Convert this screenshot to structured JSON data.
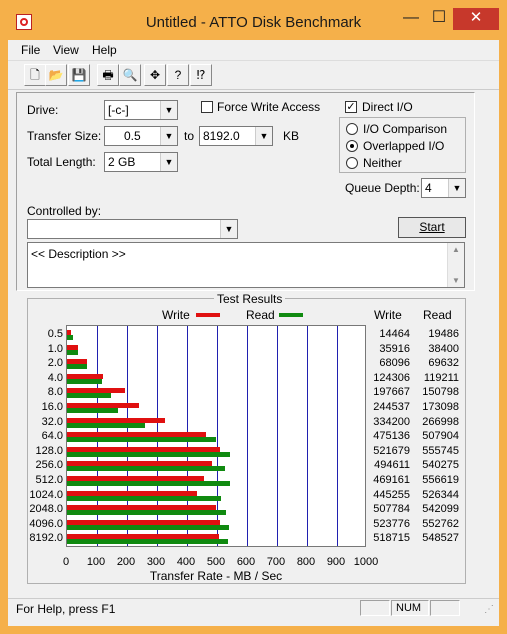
{
  "window": {
    "title": "Untitled - ATTO Disk Benchmark",
    "minimize": "—",
    "maximize": "☐",
    "close": "✕"
  },
  "menu": [
    "File",
    "View",
    "Help"
  ],
  "toolbar": [
    {
      "icon": "new-file-icon",
      "glyph": "🗋"
    },
    {
      "icon": "open-folder-icon",
      "glyph": "📂"
    },
    {
      "icon": "save-disk-icon",
      "glyph": "💾"
    },
    {
      "icon": "print-icon",
      "glyph": "🖶"
    },
    {
      "icon": "print-preview-icon",
      "glyph": "🔍"
    },
    {
      "icon": "move-icon",
      "glyph": "✥"
    },
    {
      "icon": "help-icon",
      "glyph": "?"
    },
    {
      "icon": "context-help-icon",
      "glyph": "⁉"
    }
  ],
  "settings": {
    "drive_label": "Drive:",
    "drive_value": "[-c-]",
    "force_write_label": "Force Write Access",
    "force_write_checked": false,
    "direct_io_label": "Direct I/O",
    "direct_io_checked": true,
    "transfer_size_label": "Transfer Size:",
    "transfer_from": "0.5",
    "to_label": "to",
    "transfer_to": "8192.0",
    "kb_label": "KB",
    "total_length_label": "Total Length:",
    "total_length_value": "2 GB",
    "io_options": [
      {
        "label": "I/O Comparison",
        "selected": false
      },
      {
        "label": "Overlapped I/O",
        "selected": true
      },
      {
        "label": "Neither",
        "selected": false
      }
    ],
    "queue_depth_label": "Queue Depth:",
    "queue_depth_value": "4",
    "controlled_by_label": "Controlled by:",
    "controlled_by_value": "",
    "start_label": "Start",
    "description": "<< Description >>"
  },
  "results": {
    "group_title": "Test Results",
    "legend_write": "Write",
    "legend_read": "Read",
    "col_write": "Write",
    "col_read": "Read",
    "xlabel": "Transfer Rate - MB / Sec",
    "colors": {
      "write": "#e01010",
      "read": "#108a10",
      "grid": "#2020b0"
    }
  },
  "chart_data": {
    "type": "bar",
    "orientation": "horizontal",
    "categories": [
      "0.5",
      "1.0",
      "2.0",
      "4.0",
      "8.0",
      "16.0",
      "32.0",
      "64.0",
      "128.0",
      "256.0",
      "512.0",
      "1024.0",
      "2048.0",
      "4096.0",
      "8192.0"
    ],
    "series": [
      {
        "name": "Write",
        "values": [
          14464,
          35916,
          68096,
          124306,
          197667,
          244537,
          334200,
          475136,
          521679,
          494611,
          469161,
          445255,
          507784,
          523776,
          518715
        ]
      },
      {
        "name": "Read",
        "values": [
          19486,
          38400,
          69632,
          119211,
          150798,
          173098,
          266998,
          507904,
          555745,
          540275,
          556619,
          526344,
          542099,
          552762,
          548527
        ]
      }
    ],
    "xlabel": "Transfer Rate - MB / Sec",
    "xticks": [
      "0",
      "100",
      "200",
      "300",
      "400",
      "500",
      "600",
      "700",
      "800",
      "900",
      "1000"
    ],
    "xlim": [
      0,
      1000
    ],
    "units_note": "values in KB/s; axis in MB/s",
    "grid": true,
    "legend": "top"
  },
  "status": {
    "help_text": "For Help, press F1",
    "num": "NUM"
  }
}
